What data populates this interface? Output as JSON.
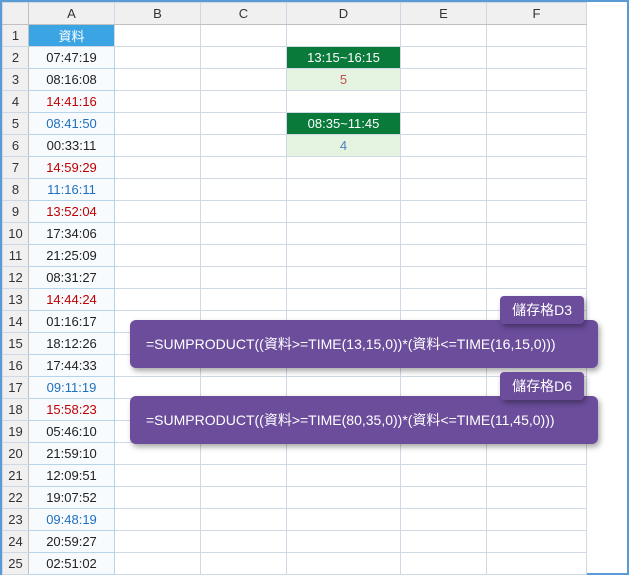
{
  "columns": [
    "A",
    "B",
    "C",
    "D",
    "E",
    "F"
  ],
  "row_count": 25,
  "header_cell": "資料",
  "col_A": [
    {
      "v": "07:47:19",
      "c": "black"
    },
    {
      "v": "08:16:08",
      "c": "black"
    },
    {
      "v": "14:41:16",
      "c": "red"
    },
    {
      "v": "08:41:50",
      "c": "blue"
    },
    {
      "v": "00:33:11",
      "c": "black"
    },
    {
      "v": "14:59:29",
      "c": "red"
    },
    {
      "v": "11:16:11",
      "c": "blue"
    },
    {
      "v": "13:52:04",
      "c": "red"
    },
    {
      "v": "17:34:06",
      "c": "black"
    },
    {
      "v": "21:25:09",
      "c": "black"
    },
    {
      "v": "08:31:27",
      "c": "black"
    },
    {
      "v": "14:44:24",
      "c": "red"
    },
    {
      "v": "01:16:17",
      "c": "black"
    },
    {
      "v": "18:12:26",
      "c": "black"
    },
    {
      "v": "17:44:33",
      "c": "black"
    },
    {
      "v": "09:11:19",
      "c": "blue"
    },
    {
      "v": "15:58:23",
      "c": "red"
    },
    {
      "v": "05:46:10",
      "c": "black"
    },
    {
      "v": "21:59:10",
      "c": "black"
    },
    {
      "v": "12:09:51",
      "c": "black"
    },
    {
      "v": "19:07:52",
      "c": "black"
    },
    {
      "v": "09:48:19",
      "c": "blue"
    },
    {
      "v": "20:59:27",
      "c": "black"
    },
    {
      "v": "02:51:02",
      "c": "black"
    }
  ],
  "d_cells": {
    "D2": {
      "v": "13:15~16:15",
      "style": "green"
    },
    "D3": {
      "v": "5",
      "style": "lightgreen-red"
    },
    "D5": {
      "v": "08:35~11:45",
      "style": "green"
    },
    "D6": {
      "v": "4",
      "style": "lightgreen-blue"
    }
  },
  "callouts": [
    {
      "tag": "儲存格D3",
      "formula": "=SUMPRODUCT((資料>=TIME(13,15,0))*(資料<=TIME(16,15,0)))"
    },
    {
      "tag": "儲存格D6",
      "formula": "=SUMPRODUCT((資料>=TIME(80,35,0))*(資料<=TIME(11,45,0)))"
    }
  ]
}
